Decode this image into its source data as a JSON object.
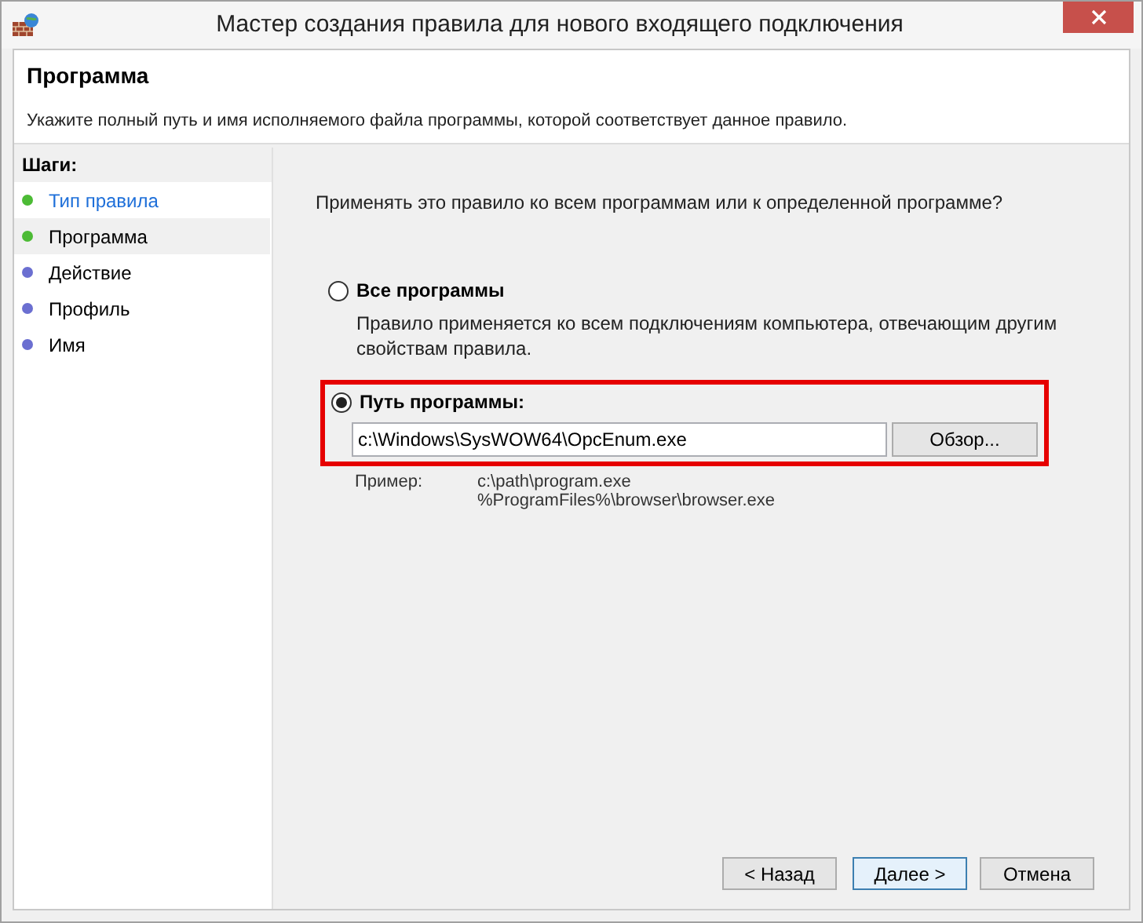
{
  "window": {
    "title": "Мастер создания правила для нового входящего подключения"
  },
  "header": {
    "title": "Программа",
    "description": "Укажите полный путь и имя исполняемого файла программы, которой соответствует данное правило."
  },
  "steps": {
    "title": "Шаги:",
    "items": [
      {
        "label": "Тип правила",
        "color": "#4cbb35",
        "selected": false
      },
      {
        "label": "Программа",
        "color": "#4cbb35",
        "selected": true
      },
      {
        "label": "Действие",
        "color": "#6b6fd1",
        "selected": false
      },
      {
        "label": "Профиль",
        "color": "#6b6fd1",
        "selected": false
      },
      {
        "label": "Имя",
        "color": "#6b6fd1",
        "selected": false
      }
    ]
  },
  "question": "Применять это правило ко всем программам или к определенной программе?",
  "options": [
    {
      "kind": "all",
      "label": "Все программы",
      "selected": false,
      "description": "Правило применяется ко всем подключениям компьютера, отвечающим другим свойствам правила."
    },
    {
      "kind": "path",
      "label": "Путь программы:",
      "selected": true,
      "value": "c:\\Windows\\SysWOW64\\OpcEnum.exe",
      "browse": "Обзор...",
      "example_label": "Пример:",
      "examples": [
        "c:\\path\\program.exe",
        "%ProgramFiles%\\browser\\browser.exe"
      ]
    }
  ],
  "buttons": [
    {
      "label": "< Назад",
      "selected": false
    },
    {
      "label": "Далее >",
      "selected": true
    },
    {
      "label": "Отмена",
      "selected": false
    }
  ]
}
